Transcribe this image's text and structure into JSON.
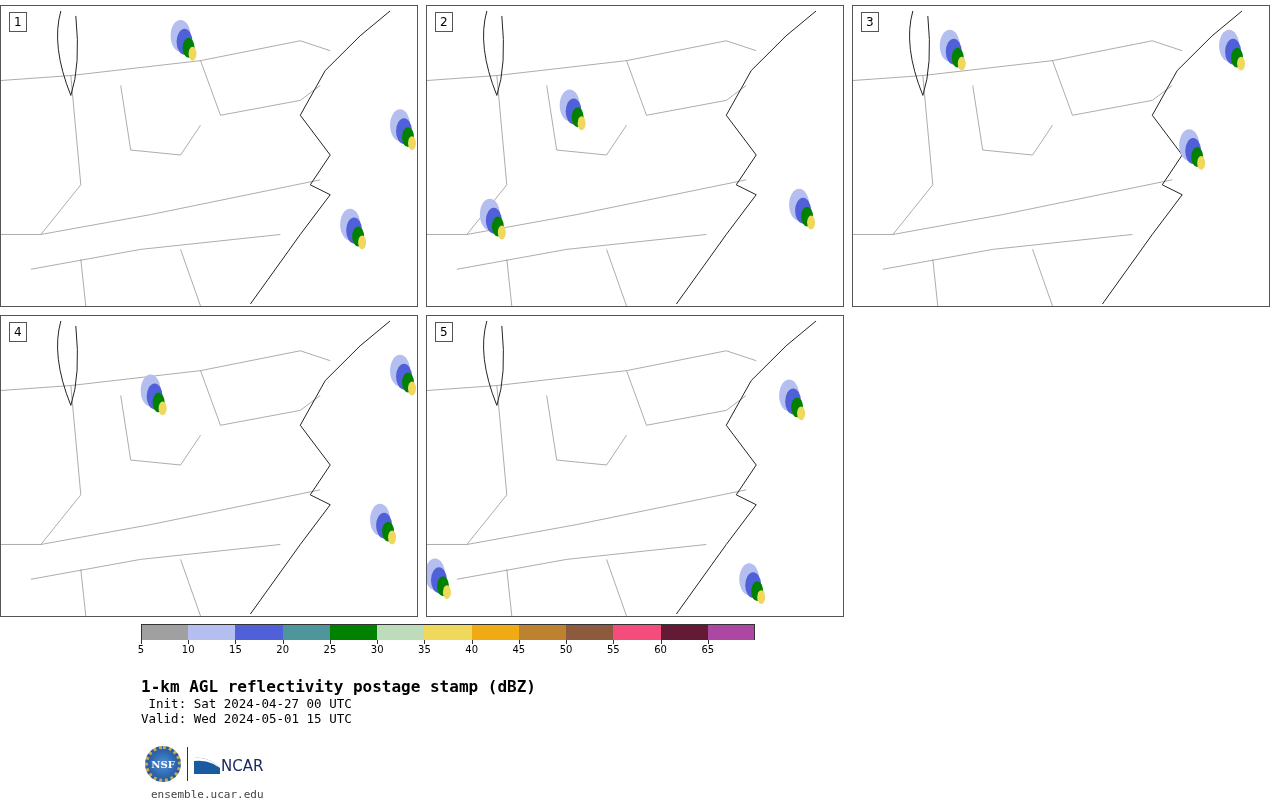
{
  "panels": [
    {
      "label": "1",
      "kind": "picture"
    },
    {
      "label": "2",
      "kind": "picture"
    },
    {
      "label": "3",
      "kind": "picture"
    },
    {
      "label": "4",
      "kind": "picture"
    },
    {
      "label": "5",
      "kind": "picture"
    }
  ],
  "colorbar": {
    "segments": [
      {
        "color": "#a0a0a0",
        "tick": "5"
      },
      {
        "color": "#b4bff0",
        "tick": "10"
      },
      {
        "color": "#5060d8",
        "tick": "15"
      },
      {
        "color": "#4f969c",
        "tick": "20"
      },
      {
        "color": "#008200",
        "tick": "25"
      },
      {
        "color": "#bcdcbc",
        "tick": "30"
      },
      {
        "color": "#f0d85c",
        "tick": "35"
      },
      {
        "color": "#f0aa14",
        "tick": "40"
      },
      {
        "color": "#bc8230",
        "tick": "45"
      },
      {
        "color": "#8c5a3c",
        "tick": "50"
      },
      {
        "color": "#f44c7c",
        "tick": "55"
      },
      {
        "color": "#641a34",
        "tick": "60"
      },
      {
        "color": "#ac48a4",
        "tick": "65"
      }
    ]
  },
  "title": "1-km AGL reflectivity postage stamp (dBZ)",
  "init": " Init: Sat 2024-04-27 00 UTC",
  "valid": "Valid: Wed 2024-05-01 15 UTC",
  "logos": {
    "nsf": "NSF",
    "ncar": "NCAR"
  },
  "url": "ensemble.ucar.edu"
}
